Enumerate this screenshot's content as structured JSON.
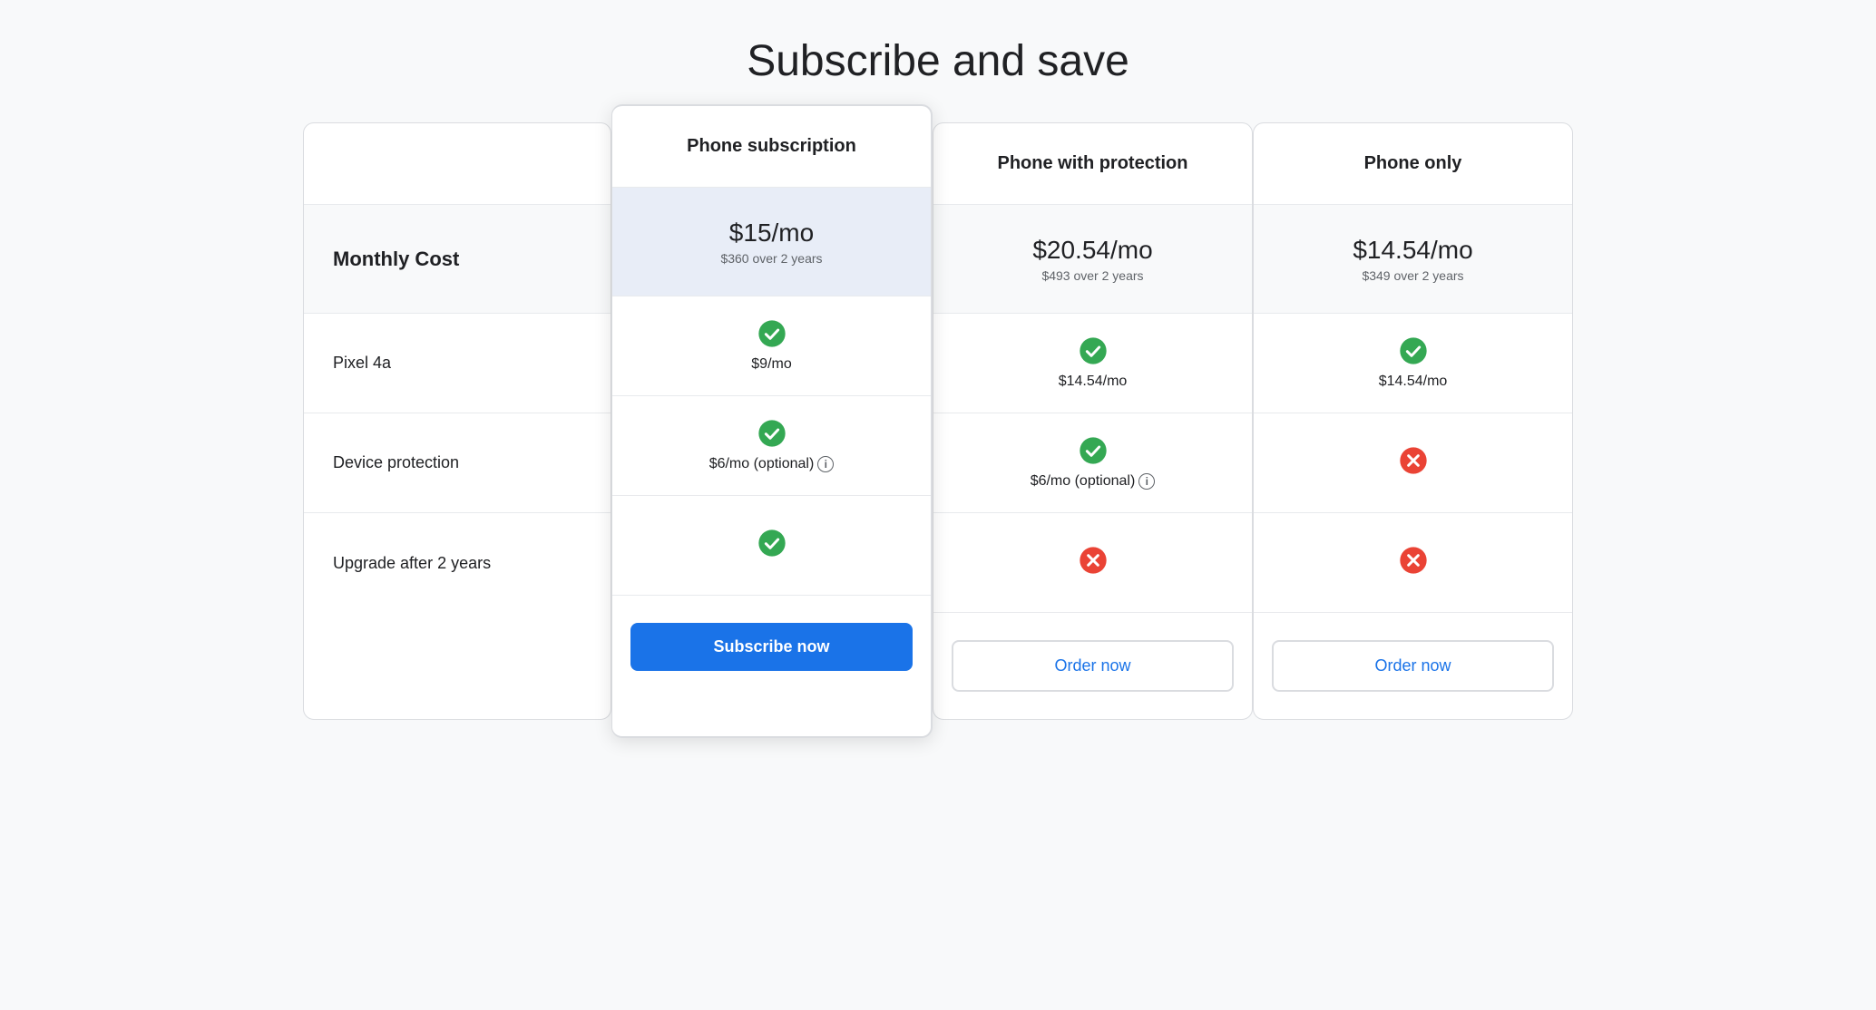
{
  "page": {
    "title": "Subscribe and save"
  },
  "labels": {
    "header": "",
    "monthly_cost": "Monthly Cost",
    "pixel": "Pixel 4a",
    "device_protection": "Device protection",
    "upgrade": "Upgrade after 2 years"
  },
  "plans": [
    {
      "id": "phone-subscription",
      "name": "Phone subscription",
      "featured": true,
      "price_main": "$15/mo",
      "price_sub": "$360 over 2 years",
      "pixel_check": true,
      "pixel_price": "$9/mo",
      "protection_check": true,
      "protection_price": "$6/mo (optional)",
      "protection_info": true,
      "upgrade_check": true,
      "upgrade_x": false,
      "cta_label": "Subscribe now",
      "cta_type": "subscribe"
    },
    {
      "id": "phone-with-protection",
      "name": "Phone with protection",
      "featured": false,
      "price_main": "$20.54/mo",
      "price_sub": "$493 over 2 years",
      "pixel_check": true,
      "pixel_price": "$14.54/mo",
      "protection_check": true,
      "protection_price": "$6/mo (optional)",
      "protection_info": true,
      "upgrade_check": false,
      "upgrade_x": true,
      "cta_label": "Order now",
      "cta_type": "order"
    },
    {
      "id": "phone-only",
      "name": "Phone only",
      "featured": false,
      "price_main": "$14.54/mo",
      "price_sub": "$349 over 2 years",
      "pixel_check": true,
      "pixel_price": "$14.54/mo",
      "protection_check": false,
      "protection_price": null,
      "protection_info": false,
      "upgrade_check": false,
      "upgrade_x": true,
      "cta_label": "Order now",
      "cta_type": "order"
    }
  ],
  "icons": {
    "check": "✓",
    "x": "✕",
    "info": "i"
  }
}
